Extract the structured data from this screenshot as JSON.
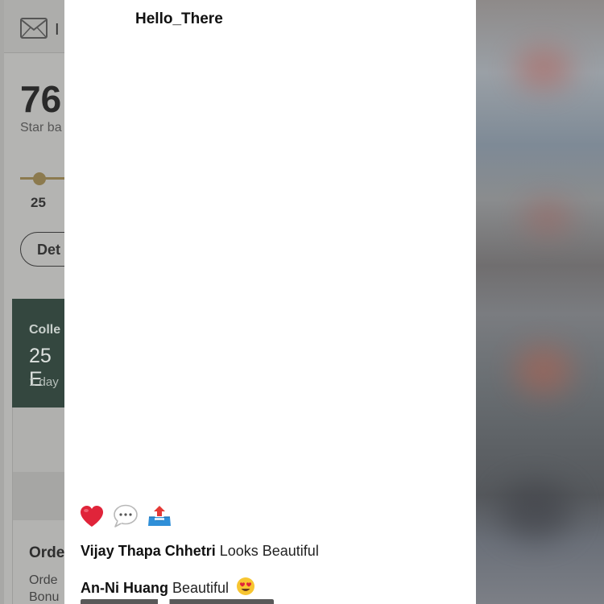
{
  "background_app": {
    "header_text": "I",
    "balance_value": "76",
    "balance_label": "Star ba",
    "progress_tick": "25",
    "button_label": "Det",
    "card": {
      "title": "Colle",
      "value": "25 E",
      "subtitle": "1 day"
    },
    "order": {
      "title": "Orde",
      "line1": "Orde",
      "line2": "Bonu"
    }
  },
  "post": {
    "username": "Hello_There",
    "actions": [
      {
        "icon": "heart-icon"
      },
      {
        "icon": "speech-bubble-icon"
      },
      {
        "icon": "outbox-tray-icon"
      }
    ],
    "comments": [
      {
        "author": "Vijay Thapa Chhetri",
        "text": "Looks Beautiful"
      },
      {
        "author": "An-Ni Huang",
        "text": "Beautiful"
      }
    ]
  },
  "colors": {
    "card_green": "#34473f",
    "slider_gold": "#8c7a4e",
    "heart_red": "#e0243a",
    "tray_blue": "#2f8fd8",
    "arrow_red": "#e53935"
  }
}
